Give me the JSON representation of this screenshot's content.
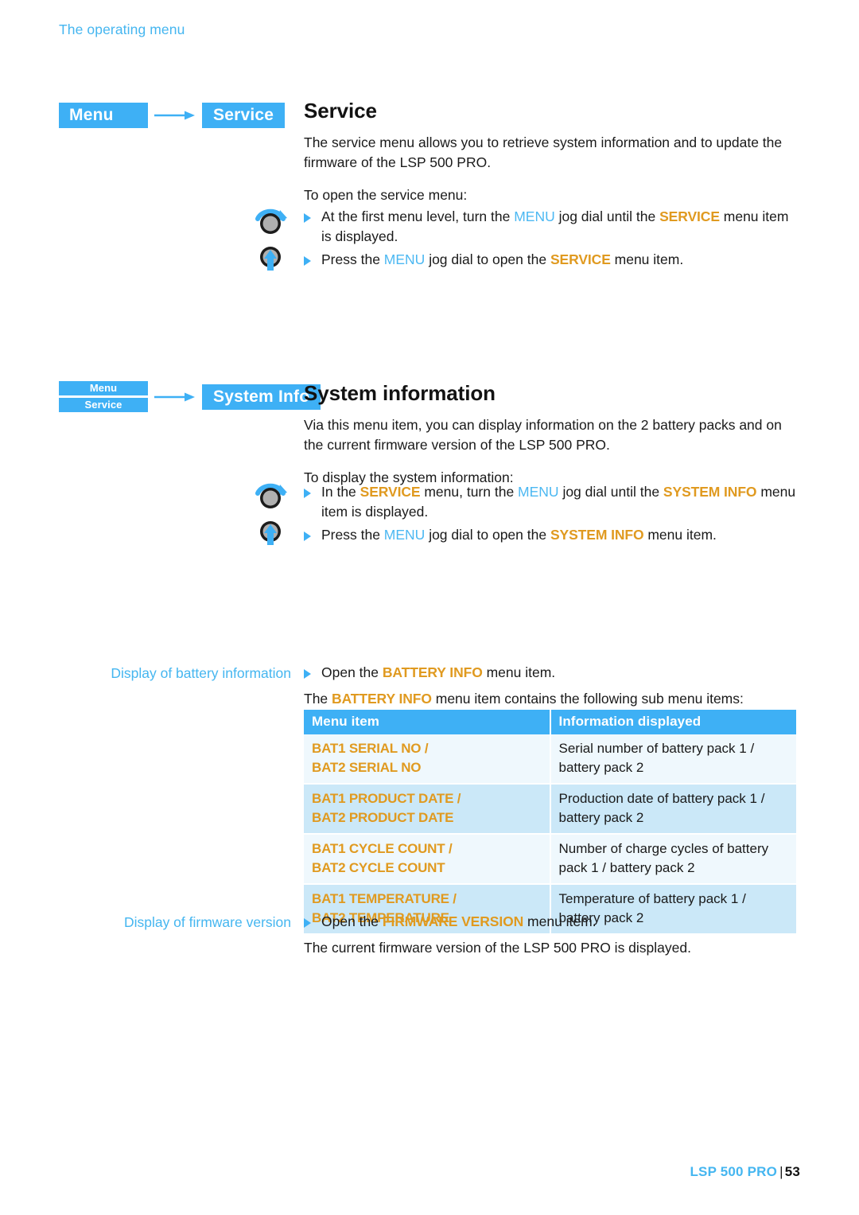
{
  "header": {
    "running_head": "The operating menu"
  },
  "nav": {
    "service": {
      "from_label": "Menu",
      "to_label": "Service",
      "arrow_icon": "arrow-right-icon"
    },
    "system_info": {
      "from_label_1": "Menu",
      "from_label_2": "Service",
      "to_label": "System Info",
      "arrow_icon": "arrow-right-icon"
    }
  },
  "sections": {
    "service": {
      "title": "Service",
      "intro": "The service menu allows you to retrieve system information and to update the firmware of the LSP 500 PRO.",
      "lead_in": "To open the service menu:",
      "steps": [
        {
          "icon": "jog-dial-turn-icon",
          "parts": [
            {
              "t": "plain",
              "v": "At the first menu level, turn the "
            },
            {
              "t": "menu",
              "v": "MENU"
            },
            {
              "t": "plain",
              "v": " jog dial until the "
            },
            {
              "t": "item",
              "v": "SERVICE"
            },
            {
              "t": "plain",
              "v": " menu item is displayed."
            }
          ]
        },
        {
          "icon": "jog-dial-press-icon",
          "parts": [
            {
              "t": "plain",
              "v": "Press the "
            },
            {
              "t": "menu",
              "v": "MENU"
            },
            {
              "t": "plain",
              "v": " jog dial to open the "
            },
            {
              "t": "item",
              "v": "SERVICE"
            },
            {
              "t": "plain",
              "v": " menu item."
            }
          ]
        }
      ]
    },
    "system_information": {
      "title": "System information",
      "intro": "Via this menu item, you can display information on the 2 battery packs and on the current firmware version of the LSP 500 PRO.",
      "lead_in": "To display the system information:",
      "steps": [
        {
          "icon": "jog-dial-turn-icon",
          "parts": [
            {
              "t": "plain",
              "v": "In the "
            },
            {
              "t": "item",
              "v": "SERVICE"
            },
            {
              "t": "plain",
              "v": " menu, turn the "
            },
            {
              "t": "menu",
              "v": "MENU"
            },
            {
              "t": "plain",
              "v": " jog dial until the "
            },
            {
              "t": "item",
              "v": "SYSTEM INFO"
            },
            {
              "t": "plain",
              "v": " menu item is displayed."
            }
          ]
        },
        {
          "icon": "jog-dial-press-icon",
          "parts": [
            {
              "t": "plain",
              "v": "Press the "
            },
            {
              "t": "menu",
              "v": "MENU"
            },
            {
              "t": "plain",
              "v": " jog dial to open the "
            },
            {
              "t": "item",
              "v": "SYSTEM INFO"
            },
            {
              "t": "plain",
              "v": " menu item."
            }
          ]
        }
      ]
    },
    "battery_information": {
      "sidenote": "Display of battery information",
      "step": [
        {
          "t": "plain",
          "v": "Open the "
        },
        {
          "t": "item",
          "v": "BATTERY INFO"
        },
        {
          "t": "plain",
          "v": " menu item."
        }
      ],
      "follow_up": [
        {
          "t": "plain",
          "v": "The "
        },
        {
          "t": "item",
          "v": "BATTERY INFO"
        },
        {
          "t": "plain",
          "v": " menu item contains the following sub menu items:"
        }
      ],
      "table": {
        "columns": [
          "Menu item",
          "Information displayed"
        ],
        "rows": [
          {
            "menu_item_line1": "BAT1 SERIAL NO /",
            "menu_item_line2": "BAT2 SERIAL NO",
            "information": "Serial number of battery pack 1 / battery pack 2"
          },
          {
            "menu_item_line1": "BAT1 PRODUCT DATE /",
            "menu_item_line2": "BAT2 PRODUCT DATE",
            "information": "Production date of battery pack 1 / battery pack 2"
          },
          {
            "menu_item_line1": "BAT1 CYCLE COUNT /",
            "menu_item_line2": "BAT2 CYCLE COUNT",
            "information": "Number of charge cycles of battery pack 1 / battery pack 2"
          },
          {
            "menu_item_line1": "BAT1 TEMPERATURE /",
            "menu_item_line2": "BAT2 TEMPERATURE",
            "information": "Temperature of battery pack 1 / battery pack 2"
          }
        ]
      }
    },
    "firmware_version": {
      "sidenote": "Display of firmware version",
      "step": [
        {
          "t": "plain",
          "v": "Open the "
        },
        {
          "t": "item",
          "v": "FIRMWARE VERSION"
        },
        {
          "t": "plain",
          "v": " menu item."
        }
      ],
      "follow_up": "The current firmware version of the LSP 500 PRO is displayed."
    }
  },
  "footer": {
    "product": "LSP 500 PRO",
    "separator": "|",
    "page_number": "53"
  },
  "colors": {
    "accent_blue": "#3eb0f5",
    "light_blue_text": "#45b6f0",
    "item_orange": "#e09a20",
    "table_row_light": "#eff8fd",
    "table_row_tint": "#cbe8f8"
  }
}
